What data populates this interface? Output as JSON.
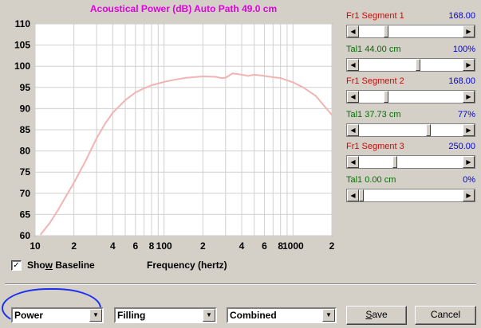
{
  "chart_title": "Acoustical Power (dB)   Auto Path 49.0 cm",
  "colors": {
    "curve": "#f0b4b4",
    "title": "#e000e0",
    "grid": "#d0d0d0",
    "accent_circle": "#1a2ff0"
  },
  "chart_data": {
    "type": "line",
    "title": "Acoustical Power (dB)   Auto Path 49.0 cm",
    "xlabel": "Frequency (hertz)",
    "ylabel": "",
    "xscale": "log",
    "xlim": [
      10,
      2000
    ],
    "ylim": [
      60,
      110
    ],
    "grid": true,
    "x_tick_labels": [
      "10",
      "2",
      "4",
      "6",
      "8",
      "100",
      "2",
      "4",
      "6",
      "8",
      "1000",
      "2"
    ],
    "y_tick_labels": [
      "110",
      "100",
      "90",
      "80",
      "70",
      "60",
      "105",
      "95",
      "85",
      "75",
      "65"
    ],
    "series": [
      {
        "x": [
          11,
          13,
          15,
          20,
          25,
          30,
          35,
          40,
          50,
          60,
          70,
          80,
          100,
          120,
          150,
          200,
          250,
          280,
          300,
          340,
          400,
          450,
          500,
          600,
          700,
          800,
          1000,
          1200,
          1500,
          2000
        ],
        "y": [
          60.2,
          63,
          66,
          72.5,
          78,
          83,
          86.5,
          89,
          92,
          93.8,
          94.8,
          95.5,
          96.3,
          96.8,
          97.3,
          97.6,
          97.5,
          97.2,
          97.3,
          98.3,
          98.0,
          97.7,
          98.0,
          97.7,
          97.4,
          97.2,
          96.2,
          95.0,
          93.0,
          88.5
        ]
      }
    ]
  },
  "baseline": {
    "label": "Show Baseline",
    "checked_mark": "✓"
  },
  "segments": [
    {
      "left": "Fr1  Segment 1",
      "right": "168.00",
      "left_color": "red",
      "right_color": "blue",
      "thumb": 0.25
    },
    {
      "left": "Tal1  44.00 cm",
      "right": "100%",
      "left_color": "green",
      "right_color": "blue",
      "thumb": 0.57
    },
    {
      "left": "Fr1  Segment 2",
      "right": "168.00",
      "left_color": "red",
      "right_color": "blue",
      "thumb": 0.25
    },
    {
      "left": "Tal1  37.73 cm",
      "right": "77%",
      "left_color": "green",
      "right_color": "blue",
      "thumb": 0.68
    },
    {
      "left": "Fr1  Segment 3",
      "right": "250.00",
      "left_color": "red",
      "right_color": "blue",
      "thumb": 0.34
    },
    {
      "left": "Tal1  0.00 cm",
      "right": "0%",
      "left_color": "green",
      "right_color": "blue",
      "thumb": 0.0
    }
  ],
  "combos": {
    "power": "Power",
    "filling": "Filling",
    "combined": "Combined"
  },
  "buttons": {
    "save": "Save",
    "cancel": "Cancel"
  }
}
